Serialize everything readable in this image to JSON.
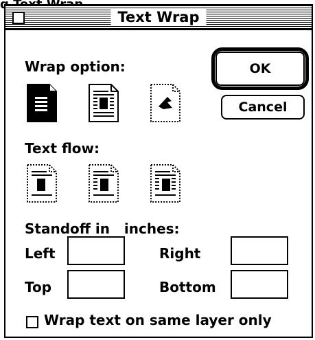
{
  "background_title": "q  Text Wrap",
  "dialog": {
    "title": "Text Wrap",
    "wrap_option_label": "Wrap option:",
    "text_flow_label": "Text flow:",
    "standoff_label": "Standoff in   inches:",
    "ok_label": "OK",
    "cancel_label": "Cancel",
    "fields": {
      "left_label": "Left",
      "right_label": "Right",
      "top_label": "Top",
      "bottom_label": "Bottom",
      "left_value": "",
      "right_value": "",
      "top_value": "",
      "bottom_value": ""
    },
    "same_layer_label": "Wrap text on same layer only",
    "same_layer_checked": false,
    "wrap_options": [
      "wrap-none-icon",
      "wrap-around-frame-icon",
      "wrap-around-shape-icon"
    ],
    "text_flow_options": [
      "flow-left-icon",
      "flow-center-icon",
      "flow-both-sides-icon"
    ]
  }
}
